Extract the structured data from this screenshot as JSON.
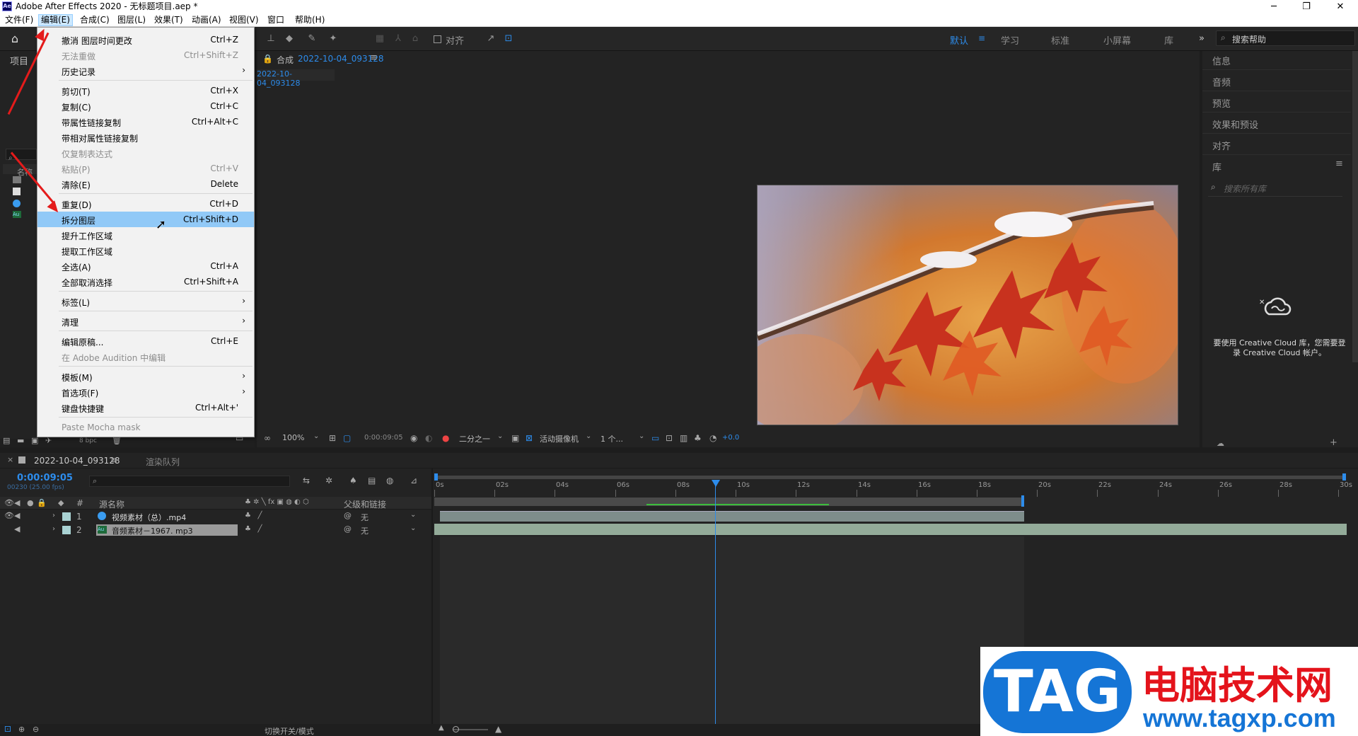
{
  "window": {
    "title": "Adobe After Effects 2020 - 无标题项目.aep *",
    "app_icon": "Ae",
    "controls": [
      "─",
      "❐",
      "✕"
    ]
  },
  "menubar": {
    "items": [
      "文件(F)",
      "编辑(E)",
      "合成(C)",
      "图层(L)",
      "效果(T)",
      "动画(A)",
      "视图(V)",
      "窗口",
      "帮助(H)"
    ]
  },
  "toolbar": {
    "align_label": "对齐",
    "workspaces": [
      "默认",
      "学习",
      "标准",
      "小屏幕",
      "库"
    ],
    "help_placeholder": "搜索帮助"
  },
  "project_panel": {
    "tab_label": "项目",
    "col_name": "名称"
  },
  "composition": {
    "tab_prefix": "合成",
    "comp_name": "2022-10-04_093128",
    "breadcrumb": "2022-10-04_093128"
  },
  "viewer_footer": {
    "zoom": "100%",
    "timecode": "0:00:09:05",
    "resolution": "二分之一",
    "camera": "活动摄像机",
    "views": "1 个...",
    "exposure": "+0.0",
    "bpc": "8 bpc"
  },
  "right_panel": {
    "items": [
      "信息",
      "音频",
      "预览",
      "效果和预设",
      "对齐",
      "库"
    ],
    "library_search_placeholder": "搜索所有库",
    "cc_message_line1": "要使用 Creative Cloud 库，您需要登",
    "cc_message_line2": "录 Creative Cloud 帐户。"
  },
  "edit_menu": {
    "items": [
      {
        "label": "撤消 图层时间更改",
        "shortcut": "Ctrl+Z",
        "disabled": false
      },
      {
        "label": "无法重做",
        "shortcut": "Ctrl+Shift+Z",
        "disabled": true
      },
      {
        "label": "历史记录",
        "shortcut": "",
        "submenu": true
      },
      {
        "label": "剪切(T)",
        "shortcut": "Ctrl+X"
      },
      {
        "label": "复制(C)",
        "shortcut": "Ctrl+C"
      },
      {
        "label": "带属性链接复制",
        "shortcut": "Ctrl+Alt+C"
      },
      {
        "label": "带相对属性链接复制",
        "shortcut": ""
      },
      {
        "label": "仅复制表达式",
        "shortcut": "",
        "disabled": true
      },
      {
        "label": "粘贴(P)",
        "shortcut": "Ctrl+V",
        "disabled": true
      },
      {
        "label": "清除(E)",
        "shortcut": "Delete"
      },
      {
        "label": "重复(D)",
        "shortcut": "Ctrl+D"
      },
      {
        "label": "拆分图层",
        "shortcut": "Ctrl+Shift+D",
        "highlighted": true
      },
      {
        "label": "提升工作区域",
        "shortcut": ""
      },
      {
        "label": "提取工作区域",
        "shortcut": ""
      },
      {
        "label": "全选(A)",
        "shortcut": "Ctrl+A"
      },
      {
        "label": "全部取消选择",
        "shortcut": "Ctrl+Shift+A"
      },
      {
        "label": "标签(L)",
        "shortcut": "",
        "submenu": true
      },
      {
        "label": "清理",
        "shortcut": "",
        "submenu": true
      },
      {
        "label": "编辑原稿...",
        "shortcut": "Ctrl+E"
      },
      {
        "label": "在 Adobe Audition 中编辑",
        "shortcut": "",
        "disabled": true
      },
      {
        "label": "模板(M)",
        "shortcut": "",
        "submenu": true
      },
      {
        "label": "首选项(F)",
        "shortcut": "",
        "submenu": true
      },
      {
        "label": "键盘快捷键",
        "shortcut": "Ctrl+Alt+'"
      },
      {
        "label": "Paste Mocha mask",
        "shortcut": "",
        "disabled": true
      }
    ]
  },
  "timeline": {
    "comp_tab": "2022-10-04_093128",
    "render_queue_tab": "渲染队列",
    "current_time": "0:00:09:05",
    "frame_info": "00230 (25.00 fps)",
    "col_source": "源名称",
    "col_parent": "父级和链接",
    "col_num": "#",
    "footer_toggle": "切换开关/模式",
    "ruler_labels": [
      "0s",
      "02s",
      "04s",
      "06s",
      "08s",
      "10s",
      "12s",
      "14s",
      "16s",
      "18s",
      "20s",
      "22s",
      "24s",
      "26s",
      "28s",
      "30s"
    ],
    "layers": [
      {
        "num": "1",
        "name": "视频素材（总）.mp4",
        "parent": "无",
        "label_color": "#a9d2d3"
      },
      {
        "num": "2",
        "name": "音频素材－1967. mp3",
        "parent": "无",
        "label_color": "#a9d2d3"
      }
    ]
  },
  "watermark": {
    "tag": "TAG",
    "cn": "电脑技术网",
    "url": "www.tagxp.com"
  },
  "colors": {
    "accent": "#2d8ceb",
    "menu_highlight": "#91c9f7",
    "arrow": "#e41b1b"
  }
}
